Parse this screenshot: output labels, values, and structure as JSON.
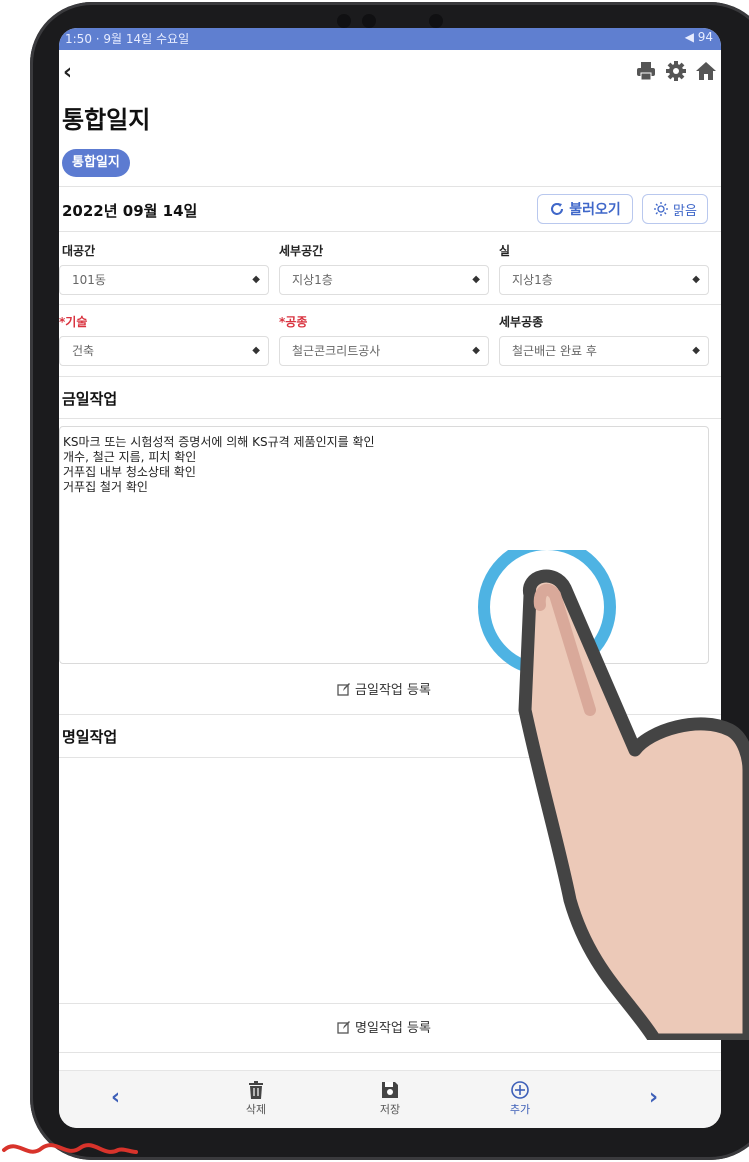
{
  "statusbar": {
    "left": "1:50 · 9월 14일 수요일",
    "right": "◀ 94"
  },
  "topbar": {
    "back": "‹"
  },
  "page": {
    "title": "통합일지",
    "chip": "통합일지"
  },
  "date": {
    "value": "2022년 09월 14일"
  },
  "buttons": {
    "load": "불러오기",
    "weather": "맑음"
  },
  "filters": {
    "row1": [
      {
        "label": "대공간",
        "value": "101동",
        "required": false
      },
      {
        "label": "세부공간",
        "value": "지상1층",
        "required": false
      },
      {
        "label": "실",
        "value": "지상1층",
        "required": false
      }
    ],
    "row2": [
      {
        "label": "*기술",
        "value": "건축",
        "required": true
      },
      {
        "label": "*공종",
        "value": "철근콘크리트공사",
        "required": true
      },
      {
        "label": "세부공종",
        "value": "철근배근 완료 후",
        "required": false
      }
    ]
  },
  "today_work": {
    "title": "금일작업",
    "lines": [
      "KS마크 또는 시험성적 증명서에 의해 KS규격 제품인지를 확인",
      "개수, 철근 지름, 피치 확인",
      "거푸집 내부 청소상태 확인",
      "거푸집 철거 확인"
    ],
    "register": "금일작업 등록"
  },
  "tomorrow_work": {
    "title": "명일작업",
    "register": "명일작업 등록"
  },
  "bottom_nav": {
    "prev": "‹",
    "delete": "삭제",
    "save": "저장",
    "add": "추가",
    "next": "›"
  },
  "colors": {
    "accent": "#5c7bd1",
    "required": "#d9333f",
    "link": "#3f67c9",
    "tap_ring": "#4eb3e3"
  },
  "icons": [
    "print-icon",
    "gear-icon",
    "home-icon",
    "refresh-icon",
    "sun-icon",
    "edit-icon",
    "trash-icon",
    "save-icon",
    "plus-circle-icon"
  ]
}
